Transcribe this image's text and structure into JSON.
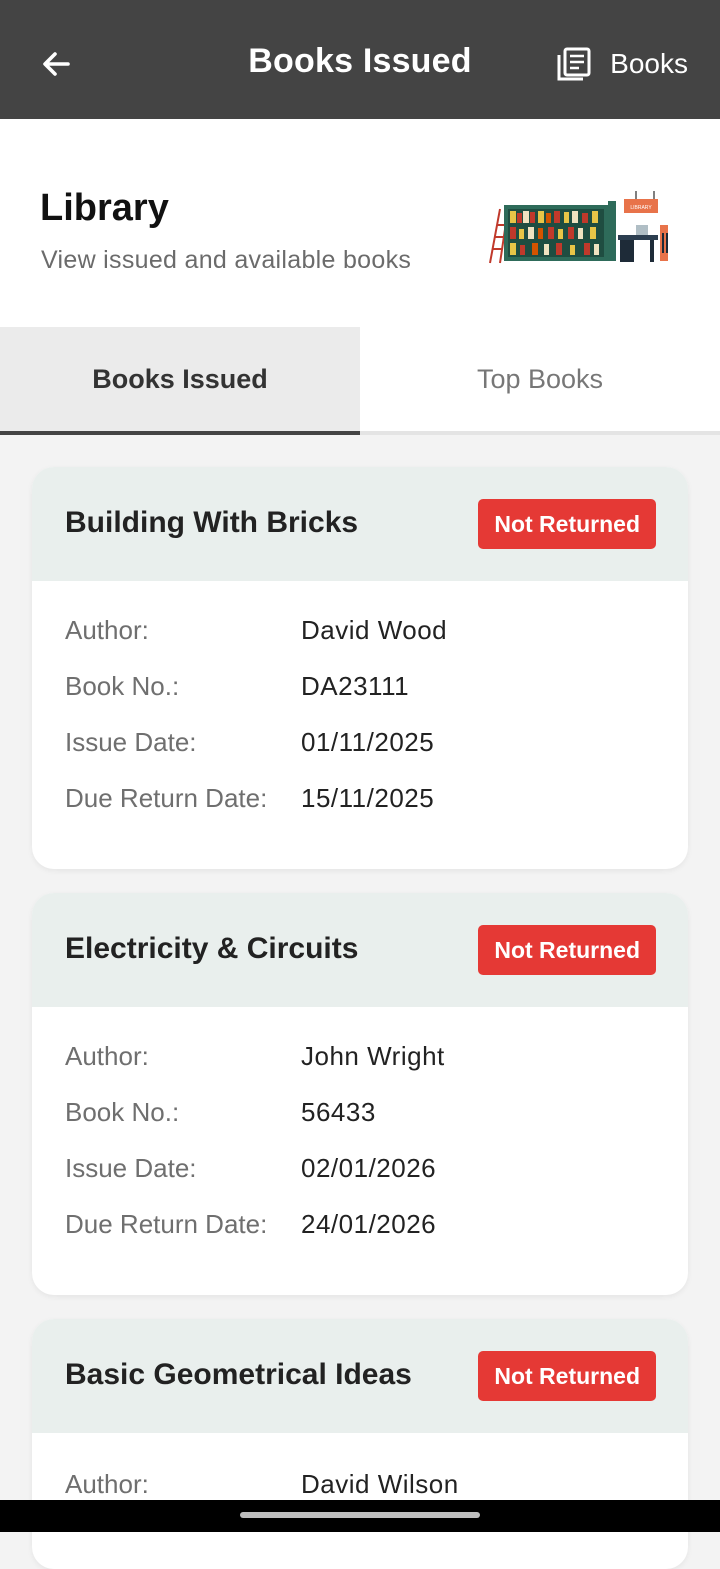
{
  "appbar": {
    "title": "Books Issued",
    "back_icon": "arrow-left-icon",
    "books_icon": "book-list-icon",
    "books_label": "Books"
  },
  "header": {
    "title": "Library",
    "subtitle": "View issued and available books",
    "illustration_sign": "LIBRARY"
  },
  "tabs": [
    {
      "label": "Books Issued",
      "active": true
    },
    {
      "label": "Top Books",
      "active": false
    }
  ],
  "field_labels": {
    "author": "Author:",
    "book_no": "Book No.:",
    "issue_date": "Issue Date:",
    "due_date": "Due Return Date:"
  },
  "books": [
    {
      "title": "Building With Bricks",
      "status": "Not Returned",
      "author": "David Wood",
      "book_no": "DA23111",
      "issue_date": "01/11/2025",
      "due_date": "15/11/2025"
    },
    {
      "title": "Electricity & Circuits",
      "status": "Not Returned",
      "author": "John Wright",
      "book_no": "56433",
      "issue_date": "02/01/2026",
      "due_date": "24/01/2026"
    },
    {
      "title": "Basic Geometrical Ideas",
      "status": "Not Returned",
      "author": "David Wilson"
    }
  ],
  "colors": {
    "appbar": "#444444",
    "badge": "#e53935",
    "card_header": "#e9efed"
  }
}
